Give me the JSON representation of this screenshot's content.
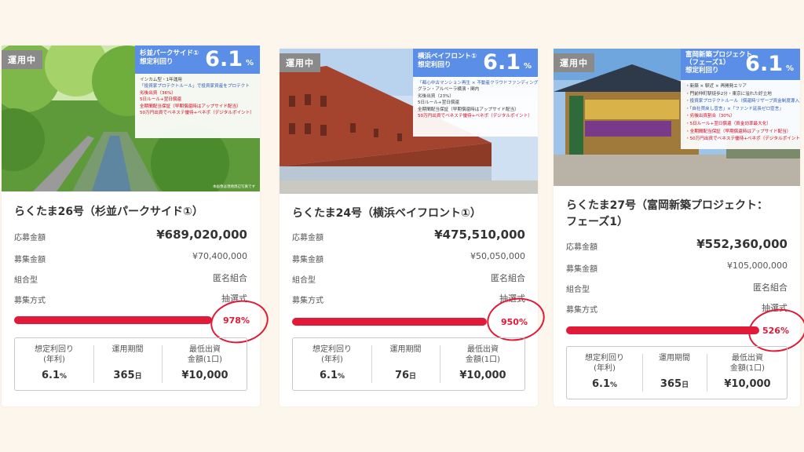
{
  "cards": [
    {
      "status": "運用中",
      "overlay": {
        "title_lines": [
          "杉並パークサイド①",
          "想定利回り"
        ],
        "rate": "6.1",
        "pct": "%",
        "lines": [
          "インカム型・1年運用",
          "「投資家プロテクトルール」で投資家資産をプロテクト",
          "劣後出資（36%）",
          "5日ルール+翌日償還",
          "全期間配当保証（早期償還時はアップサイド配当）",
          "50万円出資でベネステ優待+ベネポ（デジタルポイント）"
        ]
      },
      "caption": "本画像は現地周辺写真です",
      "title": "らくたま26号（杉並パークサイド①）",
      "rows": [
        {
          "label": "応募金額",
          "value": "¥689,020,000"
        },
        {
          "label": "募集金額",
          "value": "¥70,400,000"
        },
        {
          "label": "組合型",
          "value": "匿名組合"
        },
        {
          "label": "募集方式",
          "value": "抽選式"
        }
      ],
      "progress_pct": 978,
      "progress_label": "978%",
      "stats": [
        {
          "label": "想定利回り\n(年利)",
          "value": "6.1",
          "unit": "%"
        },
        {
          "label": "運用期間",
          "value": "365",
          "unit": "日"
        },
        {
          "label": "最低出資\n金額(1口)",
          "value": "¥10,000",
          "unit": ""
        }
      ]
    },
    {
      "status": "運用中",
      "overlay": {
        "title_lines": [
          "横浜ベイフロント①",
          "想定利回り"
        ],
        "rate": "6.1",
        "pct": "%",
        "lines": [
          "「都心中古マンション再生 × 不動産クラウドファンディング」",
          "グラン・アルベーラ横濱・関内",
          "劣後出資（23%）",
          "5日ルール+翌日償還",
          "全期間配当保証（早期償還時はアップサイド配当）",
          "50万円出資でベネステ優待+ベネポ（デジタルポイント）"
        ]
      },
      "title": "らくたま24号（横浜ベイフロント①）",
      "rows": [
        {
          "label": "応募金額",
          "value": "¥475,510,000"
        },
        {
          "label": "募集金額",
          "value": "¥50,050,000"
        },
        {
          "label": "組合型",
          "value": "匿名組合"
        },
        {
          "label": "募集方式",
          "value": "抽選式"
        }
      ],
      "progress_pct": 950,
      "progress_label": "950%",
      "stats": [
        {
          "label": "想定利回り\n(年利)",
          "value": "6.1",
          "unit": "%"
        },
        {
          "label": "運用期間",
          "value": "76",
          "unit": "日"
        },
        {
          "label": "最低出資\n金額(1口)",
          "value": "¥10,000",
          "unit": ""
        }
      ]
    },
    {
      "status": "運用中",
      "overlay": {
        "title_lines": [
          "富岡新築プロジェクト",
          "（フェーズ1）",
          "想定利回り"
        ],
        "rate": "6.1",
        "pct": "%",
        "lines": [
          "・新築 × 駅近 × 再開発エリア",
          "・門前仲町駅徒歩2分・東京に溢れた好立地",
          "・投資家プロテクトルール（償還時リザーブ資金制度導入）",
          "・「自社買戻し宣言」×「ファンド延長ゼロ宣言」",
          "・劣後出資割合（30%）",
          "・5日ルール+翌日償還（資金効率最大化）",
          "・全期間配当保証（早期償還時はアップサイド配当）",
          "・50万円出資でベネステ優待+ベネポ（デジタルポイント）"
        ]
      },
      "title": "らくたま27号（富岡新築プロジェクト：フェーズ1）",
      "rows": [
        {
          "label": "応募金額",
          "value": "¥552,360,000"
        },
        {
          "label": "募集金額",
          "value": "¥105,000,000"
        },
        {
          "label": "組合型",
          "value": "匿名組合"
        },
        {
          "label": "募集方式",
          "value": "抽選式"
        }
      ],
      "progress_pct": 526,
      "progress_label": "526%",
      "stats": [
        {
          "label": "想定利回り\n(年利)",
          "value": "6.1",
          "unit": "%"
        },
        {
          "label": "運用期間",
          "value": "365",
          "unit": "日"
        },
        {
          "label": "最低出資\n金額(1口)",
          "value": "¥10,000",
          "unit": ""
        }
      ]
    }
  ],
  "colors": {
    "accent": "#e01a38",
    "overlay_head": "#5b8ee6",
    "badge": "#8a8a8a",
    "background": "#fdf6ec"
  }
}
